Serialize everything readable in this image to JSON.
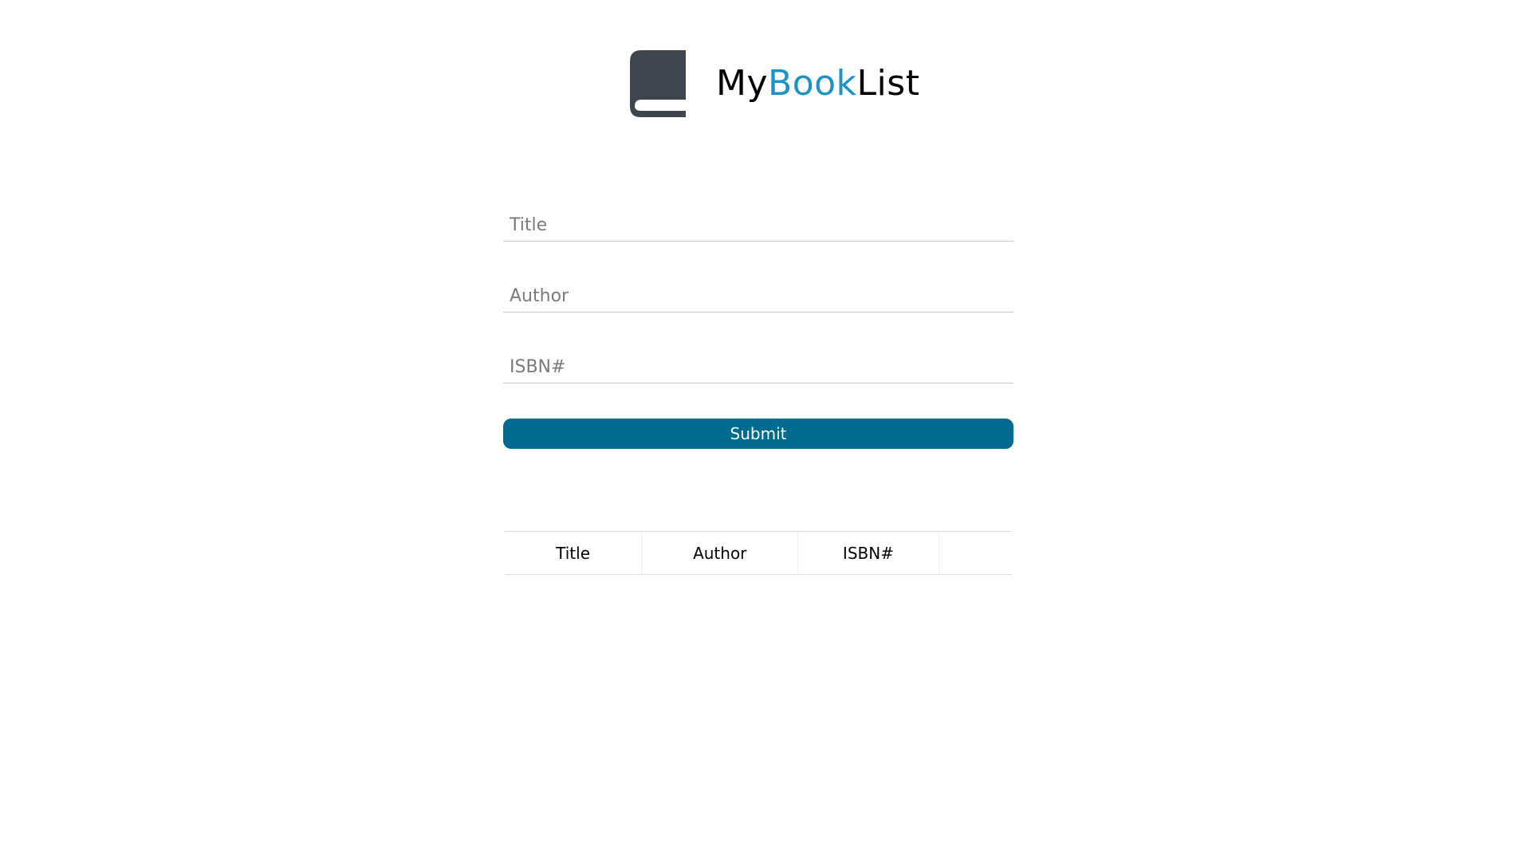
{
  "header": {
    "logo_icon": "book-icon",
    "brand_my": "My",
    "brand_book": "Book",
    "brand_list": "List",
    "accent_color": "#1b93c7"
  },
  "form": {
    "title_placeholder": "Title",
    "author_placeholder": "Author",
    "isbn_placeholder": "ISBN#",
    "submit_label": "Submit",
    "submit_color": "#006a8f"
  },
  "table": {
    "columns": [
      "Title",
      "Author",
      "ISBN#",
      ""
    ],
    "rows": []
  }
}
